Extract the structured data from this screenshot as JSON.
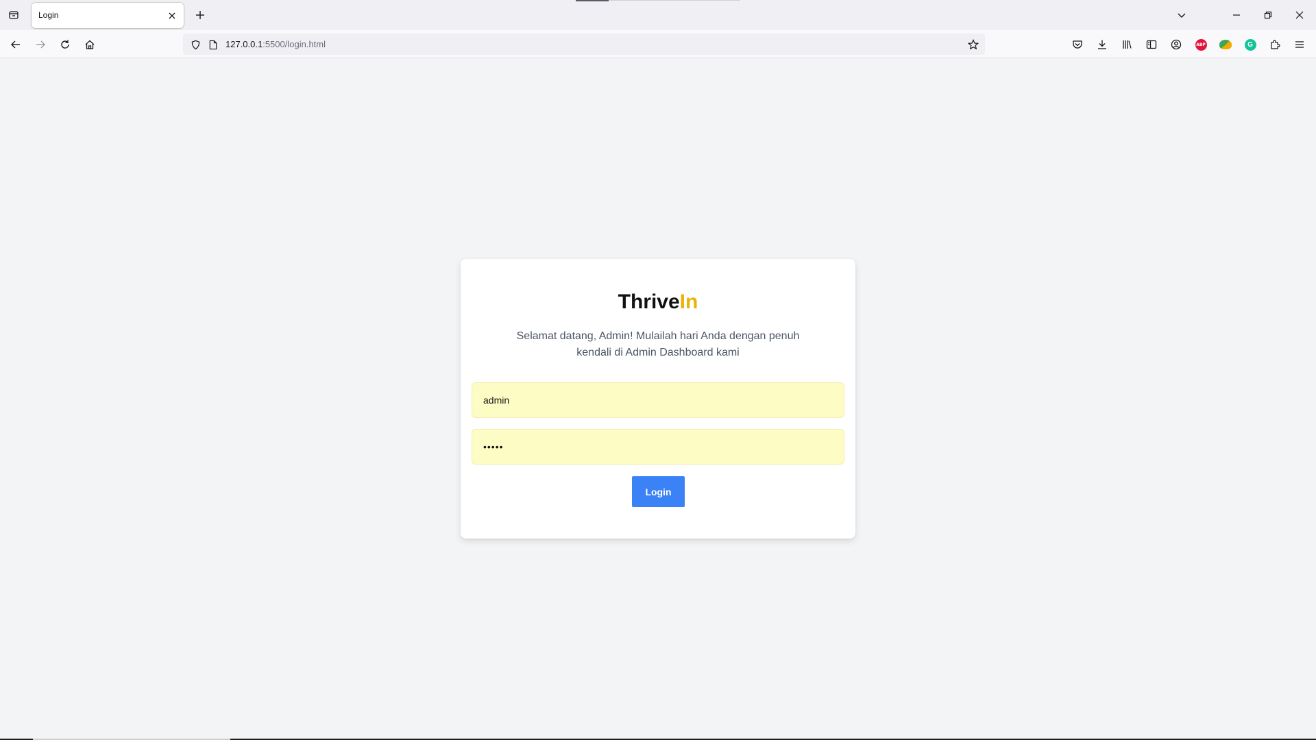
{
  "browser": {
    "tab_title": "Login",
    "url_host": "127.0.0.1",
    "url_rest": ":5500/login.html"
  },
  "login": {
    "brand_main": "Thrive",
    "brand_accent": "In",
    "welcome_text": "Selamat datang, Admin! Mulailah hari Anda dengan penuh kendali di Admin Dashboard kami",
    "username_value": "admin",
    "password_mask": "•••••",
    "button_label": "Login"
  },
  "colors": {
    "accent": "#eab308",
    "button": "#3b82f6",
    "autofill": "#fefcc5",
    "background": "#f3f4f6"
  },
  "icons": [
    "tab-list-icon",
    "close-icon",
    "plus-icon",
    "chevron-down-icon",
    "minimize-icon",
    "restore-icon",
    "window-close-icon",
    "back-icon",
    "forward-icon",
    "reload-icon",
    "home-icon",
    "shield-icon",
    "page-icon",
    "star-icon",
    "pocket-icon",
    "download-icon",
    "library-icon",
    "sidebar-icon",
    "account-icon",
    "adblock-icon",
    "vpn-icon",
    "grammarly-icon",
    "extensions-icon",
    "menu-icon"
  ]
}
